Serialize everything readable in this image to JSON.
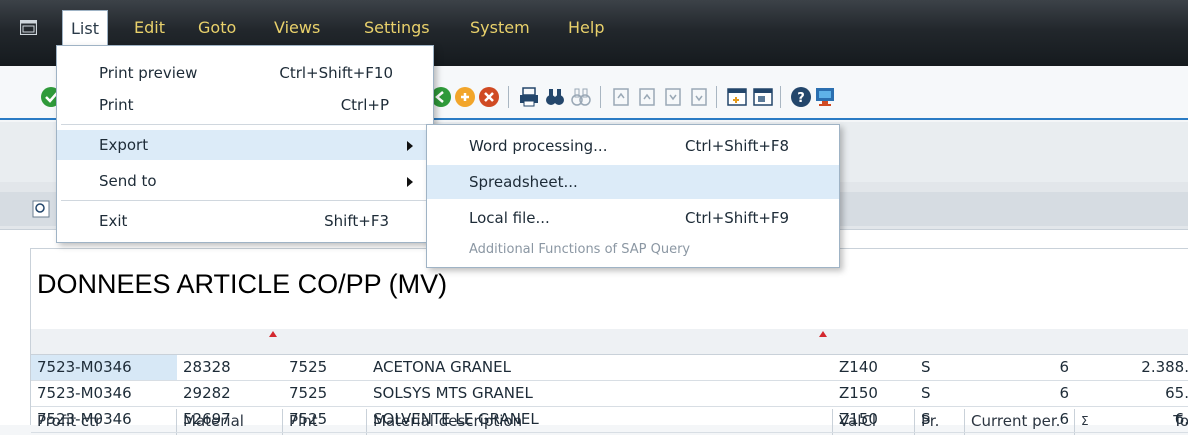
{
  "menubar": {
    "items": [
      {
        "label": "List"
      },
      {
        "label": "Edit"
      },
      {
        "label": "Goto"
      },
      {
        "label": "Views"
      },
      {
        "label": "Settings"
      },
      {
        "label": "System"
      },
      {
        "label": "Help"
      }
    ],
    "active": "List"
  },
  "list_menu": {
    "items": [
      {
        "label": "Print preview",
        "shortcut": "Ctrl+Shift+F10"
      },
      {
        "label": "Print",
        "shortcut": "Ctrl+P"
      },
      {
        "label": "Export",
        "shortcut": ""
      },
      {
        "label": "Send to",
        "shortcut": ""
      },
      {
        "label": "Exit",
        "shortcut": "Shift+F3"
      }
    ]
  },
  "export_menu": {
    "items": [
      {
        "label": "Word processing...",
        "shortcut": "Ctrl+Shift+F8"
      },
      {
        "label": "Spreadsheet...",
        "shortcut": ""
      },
      {
        "label": "Local file...",
        "shortcut": "Ctrl+Shift+F9"
      },
      {
        "label": "Additional Functions of SAP Query",
        "shortcut": ""
      }
    ],
    "highlighted": "Spreadsheet...",
    "disabled": "Additional Functions of SAP Query"
  },
  "report": {
    "title": "DONNEES ARTICLE CO/PP (MV)",
    "columns": [
      "Profit ctr",
      "Material",
      "Plnt",
      "Material description",
      "ValCl",
      "Pr.",
      "Current per.",
      "Σ",
      "To"
    ],
    "rows": [
      [
        "7523-M0346",
        "28328",
        "7525",
        "ACETONA GRANEL",
        "Z140",
        "S",
        "6",
        "2.388."
      ],
      [
        "7523-M0346",
        "29282",
        "7525",
        "SOLSYS MTS GRANEL",
        "Z150",
        "S",
        "6",
        "65."
      ],
      [
        "7523-M0346",
        "52697",
        "7525",
        "SOLVENTE LE GRANEL",
        "Z150",
        "S",
        "6",
        "6."
      ]
    ]
  },
  "colors": {
    "menubar_text": "#e9d16b",
    "accent": "#2a7bc4",
    "menu_hover": "#dcebf8",
    "sort_marker": "#d4282e"
  }
}
